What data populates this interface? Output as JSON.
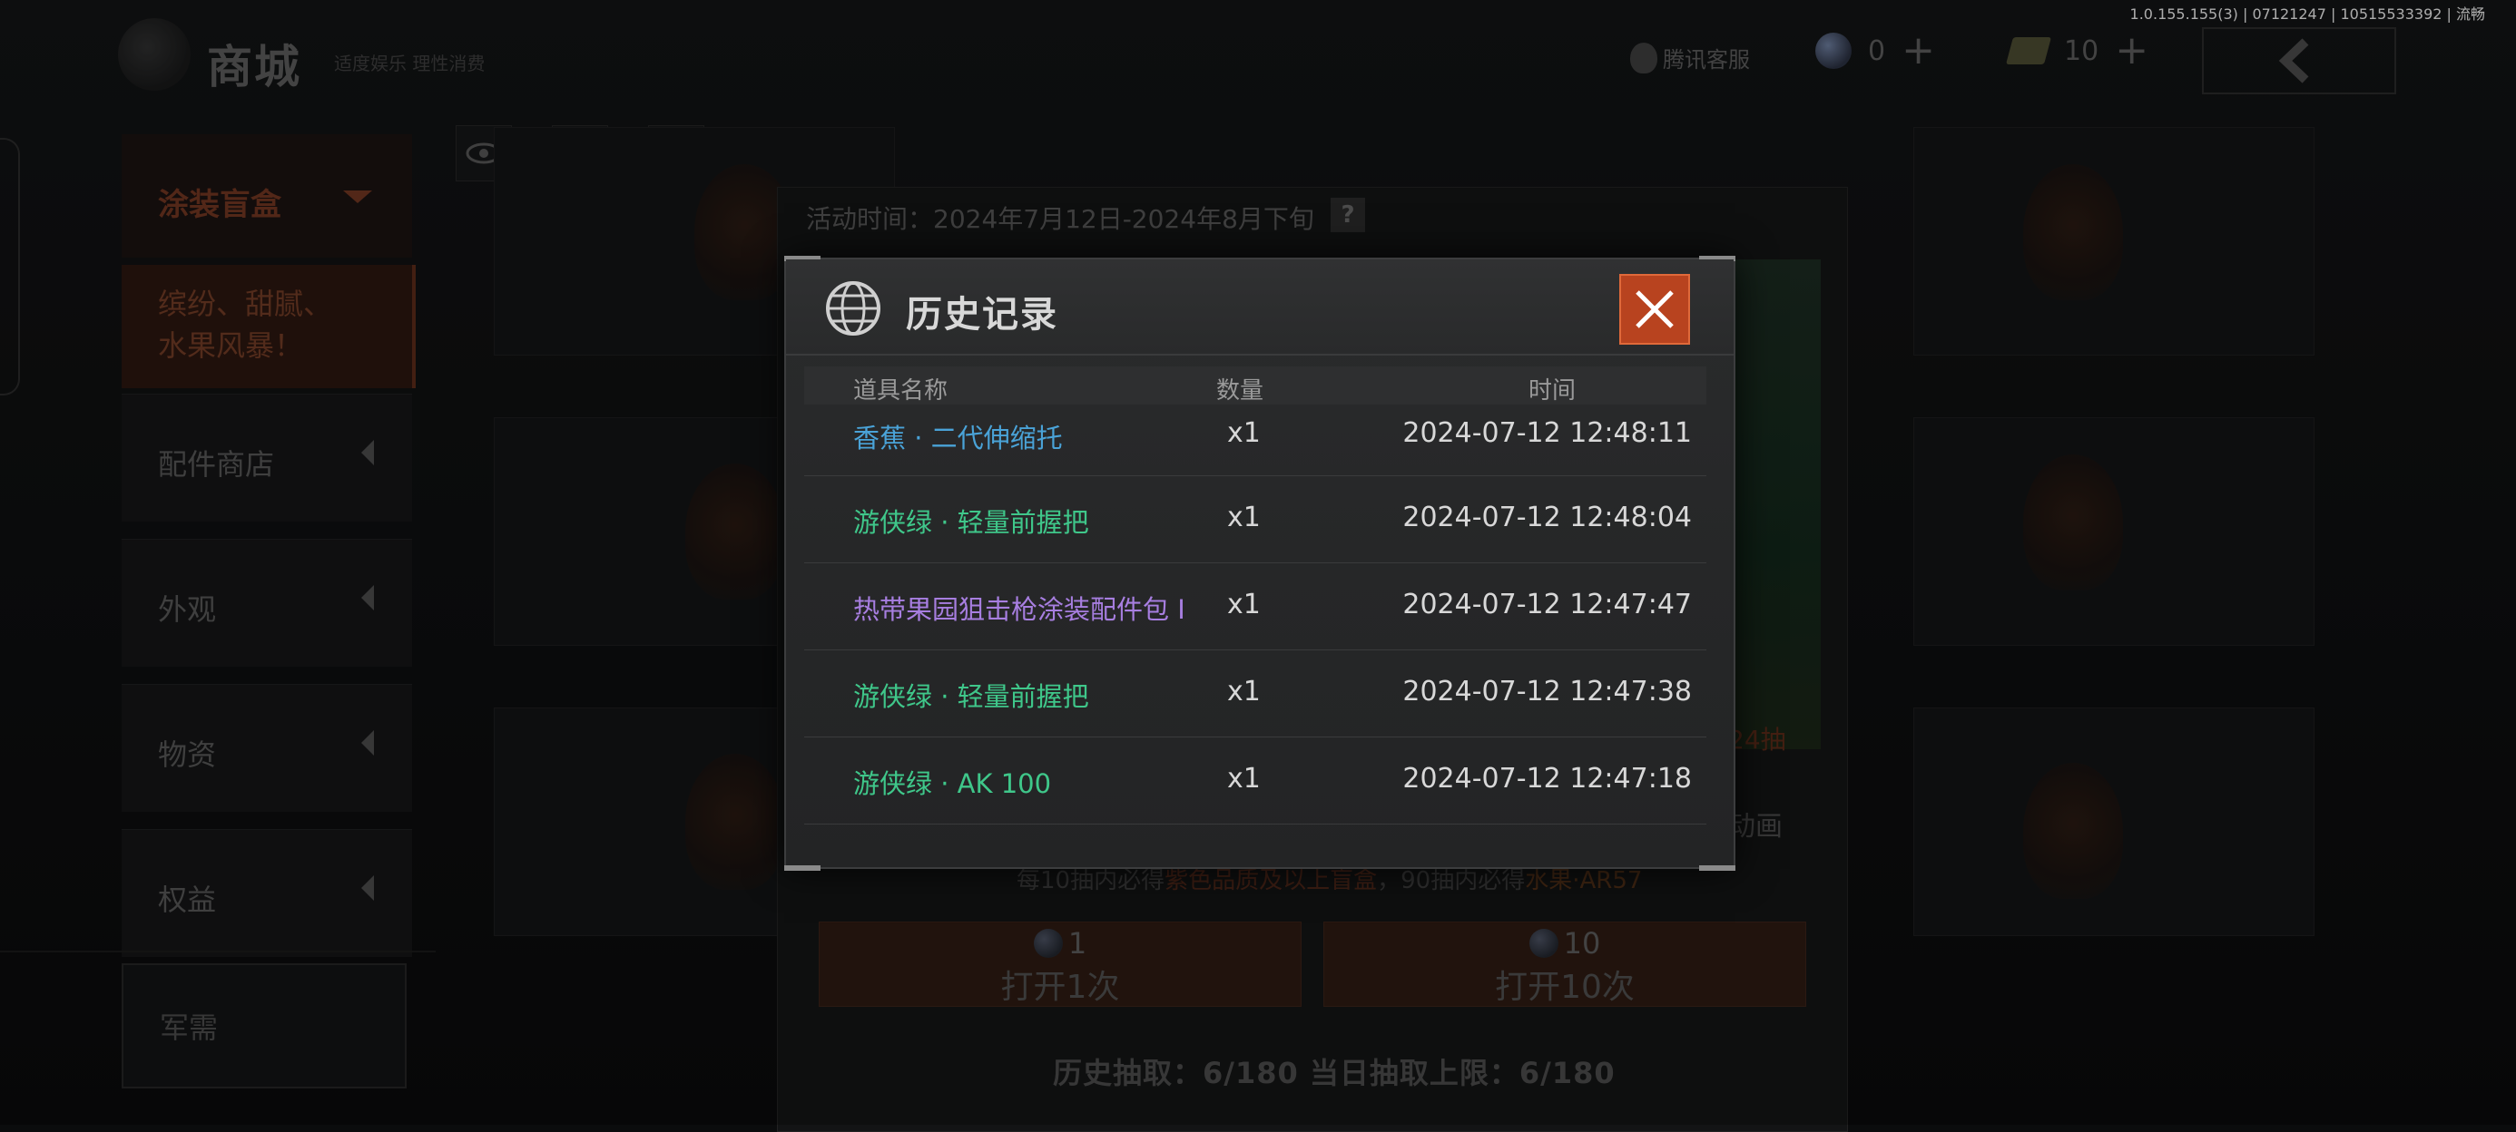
{
  "header": {
    "title": "商城",
    "subtitle": "适度娱乐 理性消费",
    "version": "1.0.155.155(3) | 07121247 | 10515533392 | 流畅",
    "support_label": "腾讯客服",
    "currency_gem_value": "0",
    "currency_ticket_value": "10"
  },
  "sidebar": {
    "active_category": "涂装盲盒",
    "active_sub": "缤纷、甜腻、水果风暴！",
    "items": [
      {
        "label": "配件商店"
      },
      {
        "label": "外观"
      },
      {
        "label": "物资"
      },
      {
        "label": "权益"
      }
    ],
    "military_label": "军需"
  },
  "event": {
    "time_label": "活动时间：2024年7月12日-2024年8月下旬",
    "help": "?",
    "draw_label": "24抽",
    "animation_label": "动画",
    "pity_prefix": "每10抽内必得",
    "pity_purple": "紫色品质及以上盲盒",
    "pity_mid": "，90抽内必得",
    "pity_orange_1": "水果",
    "pity_dot": "·",
    "pity_orange_2": "AR57",
    "open1": {
      "count": "1",
      "label": "打开1次"
    },
    "open10": {
      "count": "10",
      "label": "打开10次"
    },
    "history_line": "历史抽取：6/180 当日抽取上限：6/180"
  },
  "modal": {
    "title": "历史记录",
    "columns": {
      "name": "道具名称",
      "qty": "数量",
      "time": "时间"
    },
    "rows": [
      {
        "name": "香蕉 · 二代伸缩托",
        "qty": "x1",
        "time": "2024-07-12 12:48:11",
        "color": "#4aa3d8"
      },
      {
        "name": "游侠绿 · 轻量前握把",
        "qty": "x1",
        "time": "2024-07-12 12:48:04",
        "color": "#3fc78a"
      },
      {
        "name": "热带果园狙击枪涂装配件包 I",
        "qty": "x1",
        "time": "2024-07-12 12:47:47",
        "color": "#a77ee0"
      },
      {
        "name": "游侠绿 · 轻量前握把",
        "qty": "x1",
        "time": "2024-07-12 12:47:38",
        "color": "#3fc78a"
      },
      {
        "name": "游侠绿 · AK 100",
        "qty": "x1",
        "time": "2024-07-12 12:47:18",
        "color": "#3fc78a"
      }
    ]
  },
  "colors": {
    "close_button": "#b8431f",
    "rarity_blue": "#4aa3d8",
    "rarity_green": "#3fc78a",
    "rarity_purple": "#a77ee0"
  }
}
